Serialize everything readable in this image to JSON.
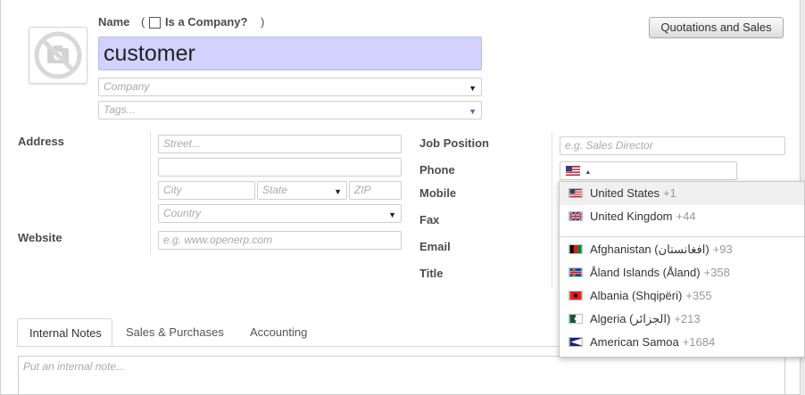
{
  "header": {
    "name_label": "Name",
    "is_company_open": "(",
    "is_company_label": "Is a Company?",
    "is_company_close": ")",
    "name_value": "customer",
    "company_placeholder": "Company",
    "tags_placeholder": "Tags...",
    "button_label": "Quotations and Sales"
  },
  "address": {
    "label": "Address",
    "street_placeholder": "Street...",
    "street2_value": "",
    "city_placeholder": "City",
    "state_placeholder": "State",
    "zip_placeholder": "ZIP",
    "country_placeholder": "Country"
  },
  "website": {
    "label": "Website",
    "placeholder": "e.g. www.openerp.com"
  },
  "right_fields": {
    "job_position_label": "Job Position",
    "job_position_placeholder": "e.g. Sales Director",
    "phone_label": "Phone",
    "mobile_label": "Mobile",
    "fax_label": "Fax",
    "email_label": "Email",
    "title_label": "Title"
  },
  "country_dropdown": {
    "preferred": [
      {
        "name": "United States",
        "dial": "+1"
      },
      {
        "name": "United Kingdom",
        "dial": "+44"
      }
    ],
    "countries": [
      {
        "name": "Afghanistan (‫افغانستان‬‎)",
        "dial": "+93"
      },
      {
        "name": "Åland Islands (Åland)",
        "dial": "+358"
      },
      {
        "name": "Albania (Shqipëri)",
        "dial": "+355"
      },
      {
        "name": "Algeria (‫الجزائر‬‎)",
        "dial": "+213"
      },
      {
        "name": "American Samoa",
        "dial": "+1684"
      }
    ]
  },
  "tabs": [
    {
      "label": "Internal Notes"
    },
    {
      "label": "Sales & Purchases"
    },
    {
      "label": "Accounting"
    }
  ],
  "notes_placeholder": "Put an internal note...",
  "icons": {
    "photo": "camera-off-icon",
    "checkbox": "checkbox-icon",
    "dropdown": "chevron-down-icon"
  }
}
